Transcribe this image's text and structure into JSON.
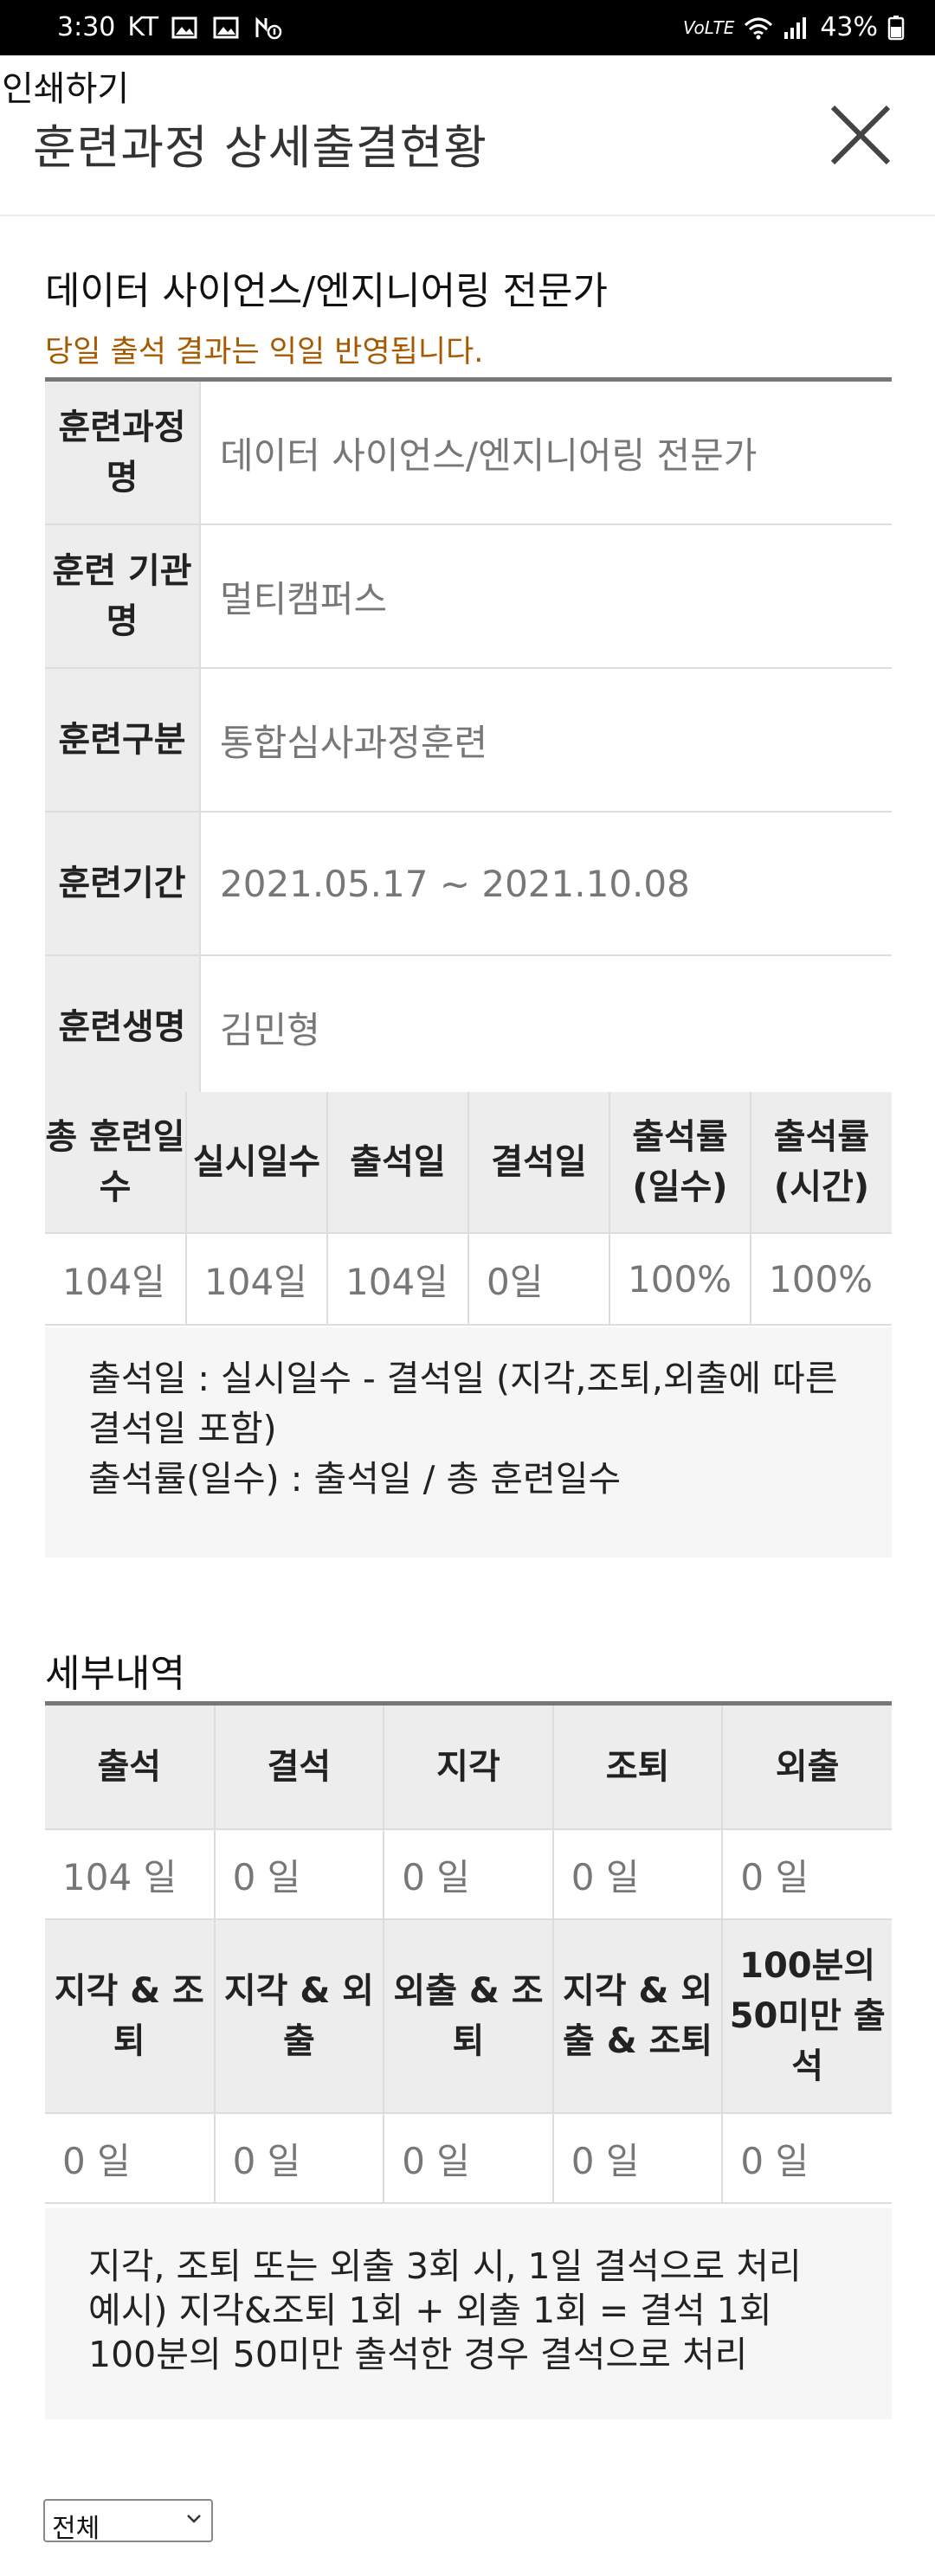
{
  "status_bar": {
    "time": "3:30",
    "carrier": "KT",
    "left_icons": [
      "image-icon",
      "image-icon",
      "nfc-icon"
    ],
    "right_icons": [
      "volte-icon",
      "wifi-icon",
      "signal-icon"
    ],
    "battery": "43%"
  },
  "header": {
    "print_label": "인쇄하기",
    "title": "훈련과정 상세출결현황"
  },
  "course": {
    "name": "데이터 사이언스/엔지니어링 전문가",
    "notice": "당일 출석 결과는 익일 반영됩니다."
  },
  "info_table": [
    {
      "label": "훈련과정명",
      "value": "데이터 사이언스/엔지니어링 전문가"
    },
    {
      "label": "훈련 기관명",
      "value": "멀티캠퍼스"
    },
    {
      "label": "훈련구분",
      "value": "통합심사과정훈련"
    },
    {
      "label": "훈련기간",
      "value": "2021.05.17 ~ 2021.10.08"
    },
    {
      "label": "훈련생명",
      "value": "김민형"
    }
  ],
  "stat_table": {
    "headers": [
      "총 훈련일수",
      "실시일수",
      "출석일",
      "결석일",
      "출석률(일수)",
      "출석률(시간)"
    ],
    "values": [
      "104일",
      "104일",
      "104일",
      "0일",
      "100%",
      "100%"
    ]
  },
  "note1": {
    "line1": "출석일 : 실시일수 - 결석일 (지각,조퇴,외출에 따른 결석일 포함)",
    "line2": "출석률(일수) : 출석일 / 총 훈련일수"
  },
  "detail": {
    "title": "세부내역",
    "headers1": [
      "출석",
      "결석",
      "지각",
      "조퇴",
      "외출"
    ],
    "values1": [
      "104 일",
      "0 일",
      "0 일",
      "0 일",
      "0 일"
    ],
    "headers2": [
      "지각 & 조퇴",
      "지각 & 외출",
      "외출 & 조퇴",
      "지각 & 외출 & 조퇴",
      "100분의 50미만 출석"
    ],
    "values2": [
      "0 일",
      "0 일",
      "0 일",
      "0 일",
      "0 일"
    ]
  },
  "note2": {
    "line1": "지각, 조퇴 또는 외출 3회 시, 1일 결석으로 처리",
    "line2": "예시) 지각&조퇴 1회 + 외출 1회 = 결석 1회",
    "line3": "100분의 50미만 출석한 경우 결석으로 처리"
  },
  "filter": {
    "selected": "전체"
  }
}
